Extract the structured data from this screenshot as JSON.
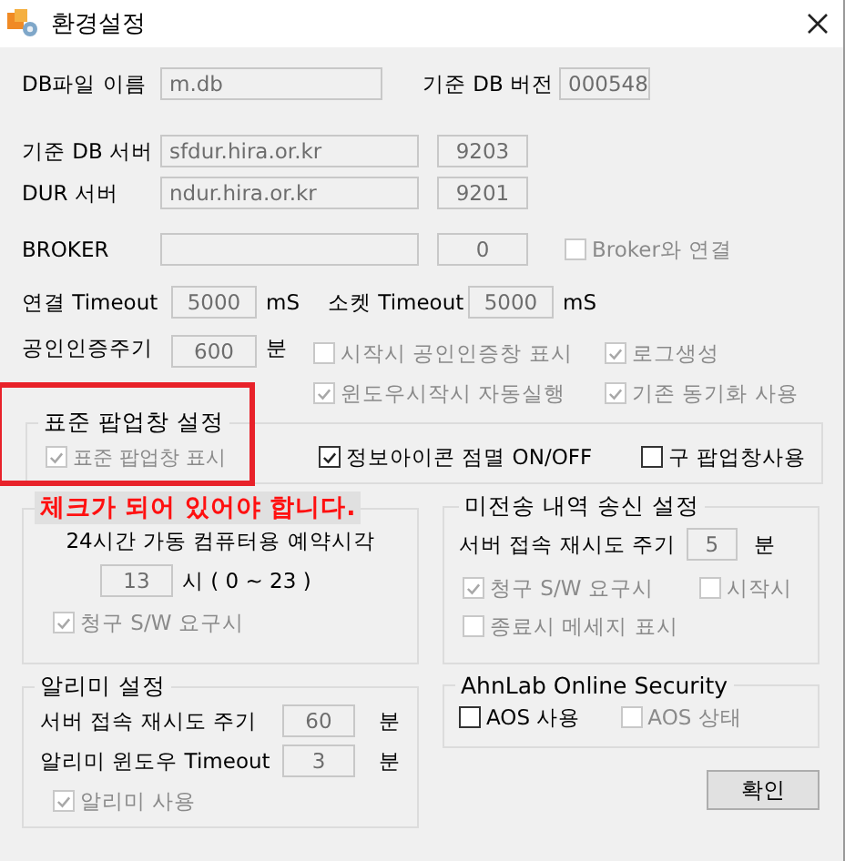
{
  "window": {
    "title": "환경설정"
  },
  "db_file": {
    "label": "DB파일 이름",
    "value": "m.db"
  },
  "db_version": {
    "label": "기준 DB 버전",
    "value": "000548"
  },
  "servers": [
    {
      "label": "기준 DB 서버",
      "host": "sfdur.hira.or.kr",
      "port": "9203"
    },
    {
      "label": "DUR 서버",
      "host": "ndur.hira.or.kr",
      "port": "9201"
    },
    {
      "label": "BROKER",
      "port": "0"
    }
  ],
  "broker_link": [
    {
      "label": "Broker와 연결",
      "checked": false,
      "disabled": true
    }
  ],
  "timeouts": [
    {
      "label": "연결 Timeout",
      "value": "5000",
      "unit": "mS"
    },
    {
      "label": "소켓 Timeout",
      "value": "5000",
      "unit": "mS"
    }
  ],
  "cert": {
    "label": "공인인증주기",
    "value": "600",
    "unit": "분"
  },
  "options": [
    {
      "label": "시작시 공인인증창 표시",
      "checked": false,
      "disabled": true
    },
    {
      "label": "로그생성",
      "checked": true,
      "disabled": true
    },
    {
      "label": "윈도우시작시 자동실행",
      "checked": true,
      "disabled": true
    },
    {
      "label": "기존 동기화 사용",
      "checked": true,
      "disabled": true
    }
  ],
  "popup_group": {
    "title": "표준 팝업창 설정",
    "highlighted": true,
    "checkboxes": [
      {
        "label": "표준 팝업창 표시",
        "checked": true,
        "disabled": true
      },
      {
        "label": "정보아이콘 점멸 ON/OFF",
        "checked": true,
        "disabled": false
      },
      {
        "label": "구 팝업창사용",
        "checked": false,
        "disabled": false
      }
    ]
  },
  "schedule_group": {
    "note": "체크가 되어 있어야 합니다.",
    "heading": "24시간 가동 컴퓨터용 예약시각",
    "value": "13",
    "unit": "시 ( 0 ~ 23 )",
    "checkboxes": [
      {
        "label": "청구 S/W 요구시",
        "checked": true,
        "disabled": true
      }
    ]
  },
  "unsent_group": {
    "title": "미전송 내역 송신 설정",
    "retry": {
      "label": "서버 접속 재시도 주기",
      "value": "5",
      "unit": "분"
    },
    "checkboxes": [
      {
        "label": "청구 S/W 요구시",
        "checked": true,
        "disabled": true
      },
      {
        "label": "시작시",
        "checked": false,
        "disabled": true
      },
      {
        "label": "종료시 메세지 표시",
        "checked": false,
        "disabled": true
      }
    ]
  },
  "notifier_group": {
    "title": "알리미 설정",
    "rows": [
      {
        "label": "서버 접속 재시도 주기",
        "value": "60",
        "unit": "분"
      },
      {
        "label": "알리미 윈도우 Timeout",
        "value": "3",
        "unit": "분"
      }
    ],
    "checkboxes": [
      {
        "label": "알리미 사용",
        "checked": true,
        "disabled": true
      }
    ]
  },
  "aos_group": {
    "title": "AhnLab Online Security",
    "checkboxes": [
      {
        "label": "AOS 사용",
        "checked": false,
        "disabled": false
      },
      {
        "label": "AOS 상태",
        "checked": false,
        "disabled": true
      }
    ]
  },
  "buttons": [
    "확인"
  ]
}
